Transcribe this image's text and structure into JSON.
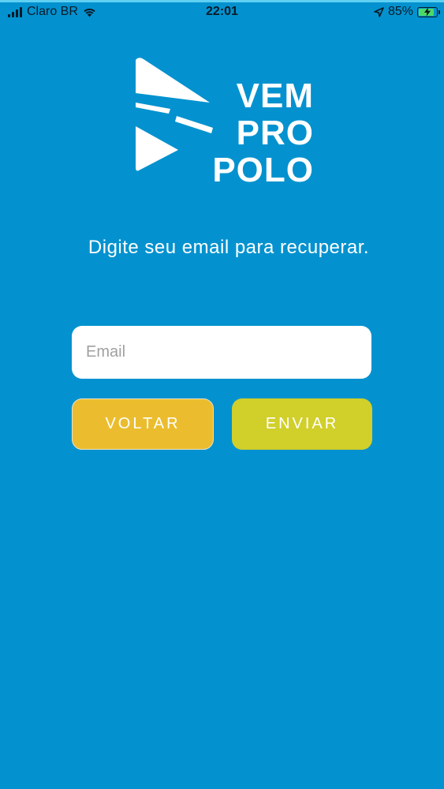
{
  "status_bar": {
    "carrier": "Claro BR",
    "time": "22:01",
    "battery_percent": "85%",
    "battery_level": 0.85,
    "icons": [
      "signal-icon",
      "wifi-icon",
      "location-arrow-icon",
      "battery-charging-icon"
    ]
  },
  "logo": {
    "line1": "VEM",
    "line2": "PRO",
    "line3": "POLO"
  },
  "recovery": {
    "prompt": "Digite seu email para recuperar.",
    "email_placeholder": "Email",
    "email_value": "",
    "back_label": "VOLTAR",
    "send_label": "ENVIAR"
  },
  "colors": {
    "background": "#0392cf",
    "back_button": "#ebbd2e",
    "send_button": "#d1cf2a",
    "input_background": "#ffffff"
  }
}
